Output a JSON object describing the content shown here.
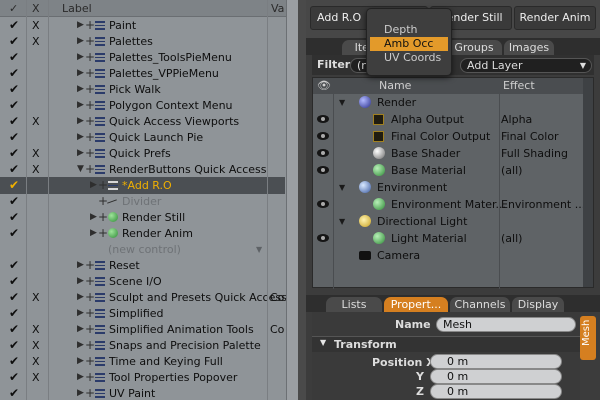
{
  "left": {
    "header": {
      "check": "✓",
      "x": "X",
      "label": "Label",
      "va": "Va"
    },
    "rows": [
      {
        "checked": true,
        "x": "X",
        "label": "Paint"
      },
      {
        "checked": true,
        "x": "X",
        "label": "Palettes"
      },
      {
        "checked": true,
        "x": "",
        "label": "Palettes_ToolsPieMenu"
      },
      {
        "checked": true,
        "x": "",
        "label": "Palettes_VPPieMenu"
      },
      {
        "checked": true,
        "x": "",
        "label": "Pick Walk"
      },
      {
        "checked": true,
        "x": "",
        "label": "Polygon Context Menu"
      },
      {
        "checked": true,
        "x": "X",
        "label": "Quick Access Viewports"
      },
      {
        "checked": true,
        "x": "",
        "label": "Quick Launch Pie"
      },
      {
        "checked": true,
        "x": "X",
        "label": "Quick Prefs"
      },
      {
        "checked": true,
        "x": "X",
        "label": "RenderButtons Quick Access"
      },
      {
        "checked": true,
        "x": "",
        "label": "*Add R.O",
        "selected": true
      },
      {
        "checked": true,
        "x": "",
        "label": "Divider",
        "dim": true
      },
      {
        "checked": true,
        "x": "",
        "label": "Render Still"
      },
      {
        "checked": true,
        "x": "",
        "label": "Render Anim"
      },
      {
        "checked": false,
        "x": "",
        "label": "(new control)",
        "dim": true
      },
      {
        "checked": true,
        "x": "",
        "label": "Reset"
      },
      {
        "checked": true,
        "x": "",
        "label": "Scene I/O"
      },
      {
        "checked": true,
        "x": "X",
        "label": "Sculpt and Presets Quick Access",
        "va": "Co"
      },
      {
        "checked": true,
        "x": "",
        "label": "Simplified"
      },
      {
        "checked": true,
        "x": "X",
        "label": "Simplified Animation Tools",
        "va": "Co"
      },
      {
        "checked": true,
        "x": "X",
        "label": "Snaps and Precision Palette"
      },
      {
        "checked": true,
        "x": "X",
        "label": "Time and Keying Full"
      },
      {
        "checked": true,
        "x": "X",
        "label": "Tool Properties Popover"
      },
      {
        "checked": true,
        "x": "",
        "label": "UV Paint"
      }
    ]
  },
  "toolbar": {
    "add_ro": "Add R.O",
    "render_still": "Render Still",
    "render_anim": "Render Anim"
  },
  "popup": {
    "items": [
      "Depth",
      "Amb Occ",
      "UV Coords"
    ],
    "active_index": 1
  },
  "top_tabs": {
    "items": "Items",
    "groups": "Groups",
    "images": "Images"
  },
  "filter": {
    "label": "Filter",
    "value": "(none)",
    "add_layer": "Add Layer"
  },
  "item_list": {
    "col_name": "Name",
    "col_effect": "Effect",
    "rows": [
      {
        "name": "Render",
        "effect": "",
        "eye": false
      },
      {
        "name": "Alpha Output",
        "effect": "Alpha",
        "eye": true
      },
      {
        "name": "Final Color Output",
        "effect": "Final Color",
        "eye": true
      },
      {
        "name": "Base Shader",
        "effect": "Full Shading",
        "eye": true
      },
      {
        "name": "Base Material",
        "effect": "(all)",
        "eye": true
      },
      {
        "name": "Environment",
        "effect": "",
        "eye": false
      },
      {
        "name": "Environment Mater...",
        "effect": "Environment ...",
        "eye": true
      },
      {
        "name": "Directional Light",
        "effect": "",
        "eye": false
      },
      {
        "name": "Light Material",
        "effect": "(all)",
        "eye": true
      },
      {
        "name": "Camera",
        "effect": "",
        "eye": false
      }
    ]
  },
  "bottom_tabs": {
    "lists": "Lists",
    "properties": "Propert...",
    "channels": "Channels",
    "display": "Display"
  },
  "properties": {
    "name_label": "Name",
    "name_value": "Mesh",
    "section": "Transform",
    "pos_x_label": "Position X",
    "pos_y_label": "Y",
    "pos_z_label": "Z",
    "pos_x": "0 m",
    "pos_y": "0 m",
    "pos_z": "0 m",
    "side_tab": "Mesh"
  },
  "colors": {
    "accent_orange": "#d57f20",
    "selection_gold": "#f0b000"
  }
}
